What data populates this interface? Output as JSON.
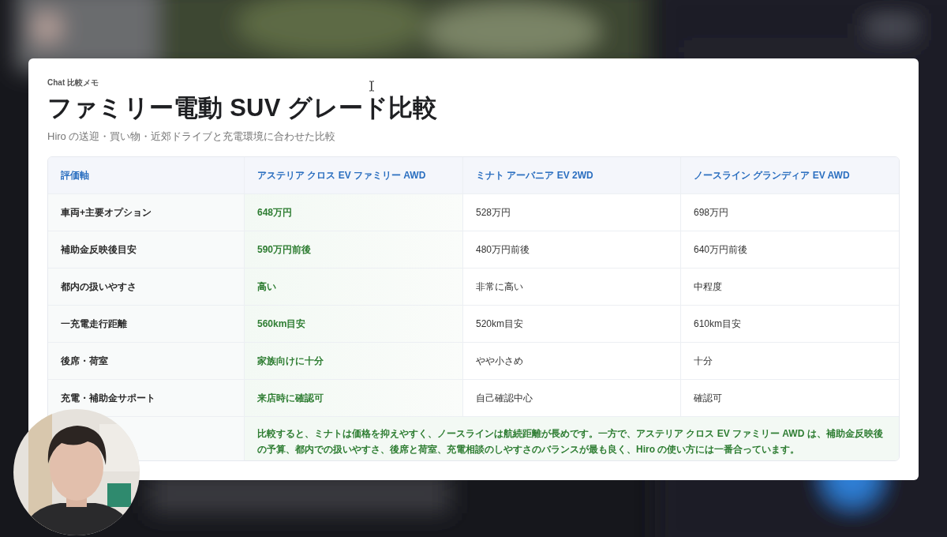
{
  "card": {
    "eyebrow": "Chat 比較メモ",
    "title": "ファミリー電動 SUV グレード比較",
    "subtitle": "Hiro の送迎・買い物・近郊ドライブと充電環境に合わせた比較"
  },
  "table": {
    "columns": [
      {
        "label": "評価軸",
        "highlighted": false
      },
      {
        "label": "アステリア クロス EV ファミリー AWD",
        "highlighted": true
      },
      {
        "label": "ミナト アーバニア EV 2WD",
        "highlighted": false
      },
      {
        "label": "ノースライン グランディア EV AWD",
        "highlighted": false
      }
    ],
    "rows": [
      {
        "cells": [
          "車両+主要オプション",
          "648万円",
          "528万円",
          "698万円"
        ]
      },
      {
        "cells": [
          "補助金反映後目安",
          "590万円前後",
          "480万円前後",
          "640万円前後"
        ]
      },
      {
        "cells": [
          "都内の扱いやすさ",
          "高い",
          "非常に高い",
          "中程度"
        ]
      },
      {
        "cells": [
          "一充電走行距離",
          "560km目安",
          "520km目安",
          "610km目安"
        ]
      },
      {
        "cells": [
          "後席・荷室",
          "家族向けに十分",
          "やや小さめ",
          "十分"
        ]
      },
      {
        "cells": [
          "充電・補助金サポート",
          "来店時に確認可",
          "自己確認中心",
          "確認可"
        ]
      }
    ],
    "summary": "比較すると、ミナトは価格を抑えやすく、ノースラインは航続距離が長めです。一方で、アステリア クロス EV ファミリー AWD は、補助金反映後の予算、都内での扱いやすさ、後席と荷室、充電相談のしやすさのバランスが最も良く、Hiro の使い方には一番合っています。"
  }
}
